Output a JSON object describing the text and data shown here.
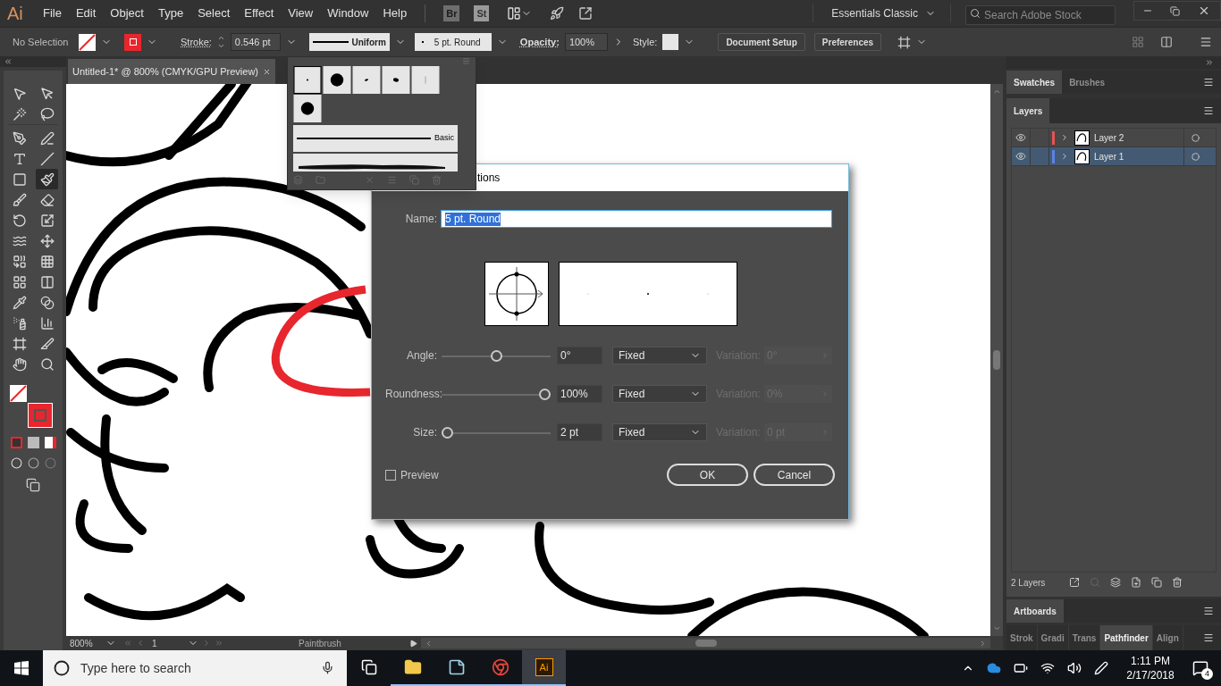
{
  "app": {
    "logo": "Ai",
    "bridge": "Br",
    "stock": "St"
  },
  "menu": [
    "File",
    "Edit",
    "Object",
    "Type",
    "Select",
    "Effect",
    "View",
    "Window",
    "Help"
  ],
  "workspace": {
    "label": "Essentials Classic"
  },
  "stock_search": {
    "placeholder": "Search Adobe Stock"
  },
  "control_bar": {
    "selection": "No Selection",
    "stroke_label": "Stroke:",
    "stroke_value": "0.546 pt",
    "profile": "Uniform",
    "brush": "5 pt. Round",
    "opacity_label": "Opacity:",
    "opacity_value": "100%",
    "style_label": "Style:",
    "buttons": [
      "Document Setup",
      "Preferences"
    ]
  },
  "tools": [
    {
      "kind": "selection",
      "selected": false
    },
    {
      "kind": "direct-selection",
      "selected": false
    },
    {
      "kind": "magic-wand",
      "selected": false
    },
    {
      "kind": "lasso",
      "selected": false
    },
    {
      "kind": "pen",
      "selected": false
    },
    {
      "kind": "curvature",
      "selected": false
    },
    {
      "kind": "type",
      "selected": false
    },
    {
      "kind": "line",
      "selected": false
    },
    {
      "kind": "rectangle",
      "selected": false
    },
    {
      "kind": "paintbrush",
      "selected": true
    },
    {
      "kind": "shaper",
      "selected": false
    },
    {
      "kind": "eraser",
      "selected": false
    },
    {
      "kind": "rotate",
      "selected": false
    },
    {
      "kind": "scale",
      "selected": false
    },
    {
      "kind": "width",
      "selected": false
    },
    {
      "kind": "free-transform",
      "selected": false
    },
    {
      "kind": "shape-builder",
      "selected": false
    },
    {
      "kind": "perspective",
      "selected": false
    },
    {
      "kind": "mesh",
      "selected": false
    },
    {
      "kind": "gradient",
      "selected": false
    },
    {
      "kind": "eyedropper",
      "selected": false
    },
    {
      "kind": "blend",
      "selected": false
    },
    {
      "kind": "symbol-sprayer",
      "selected": false
    },
    {
      "kind": "graph",
      "selected": false
    },
    {
      "kind": "artboard",
      "selected": false
    },
    {
      "kind": "slice",
      "selected": false
    },
    {
      "kind": "hand",
      "selected": false
    },
    {
      "kind": "zoom",
      "selected": false
    }
  ],
  "document_tab": {
    "title": "Untitled-1* @ 800% (CMYK/GPU Preview)"
  },
  "brush_popup": {
    "brushes": [
      {
        "kind": "dot",
        "selected": true
      },
      {
        "kind": "blob",
        "selected": false
      },
      {
        "kind": "tilt",
        "selected": false
      },
      {
        "kind": "oval",
        "selected": false
      },
      {
        "kind": "tick",
        "selected": false
      },
      {
        "kind": "blob",
        "selected": false
      }
    ],
    "rows": [
      {
        "kind": "line",
        "label": "Basic"
      },
      {
        "kind": "charcoal"
      }
    ]
  },
  "dialog": {
    "title": "tions",
    "name_label": "Name:",
    "name_value": "5 pt. Round",
    "sliders": [
      {
        "label": "Angle:",
        "level": 0.5,
        "value": "0°",
        "mode": "Fixed",
        "variation_label": "Variation:",
        "variation_value": "0°",
        "disabled": true
      },
      {
        "label": "Roundness:",
        "level": 1,
        "value": "100%",
        "mode": "Fixed",
        "variation_label": "Variation:",
        "variation_value": "0%",
        "disabled": true
      },
      {
        "label": "Size:",
        "level": 0,
        "value": "2 pt",
        "mode": "Fixed",
        "variation_label": "Variation:",
        "variation_value": "0 pt",
        "disabled": true
      }
    ],
    "preview": {
      "label": "Preview",
      "checked": false
    },
    "buttons": [
      "OK",
      "Cancel"
    ]
  },
  "panels": {
    "tabs": [
      {
        "label": "Swatches",
        "selected": true
      },
      {
        "label": "Brushes",
        "selected": false
      }
    ],
    "layers_title": "Layers",
    "layers": [
      {
        "name": "Layer 2",
        "color": "#e85252",
        "visible": true,
        "selected": false
      },
      {
        "name": "Layer 1",
        "color": "#5a82e6",
        "visible": true,
        "selected": true
      }
    ],
    "count": "2 Layers",
    "artboards": "Artboards",
    "bottom_tabs": [
      {
        "label": "Strok",
        "selected": false
      },
      {
        "label": "Gradi",
        "selected": false
      },
      {
        "label": "Trans",
        "selected": false
      },
      {
        "label": "Pathfinder",
        "selected": true
      },
      {
        "label": "Align",
        "selected": false
      }
    ]
  },
  "status_bar": {
    "zoom": "800%",
    "artboard": "1",
    "tool": "Paintbrush"
  },
  "taskbar": {
    "search_placeholder": "Type here to search",
    "apps": [
      {
        "kind": "task-view",
        "open": false,
        "active": false
      },
      {
        "kind": "explorer",
        "open": true,
        "active": false
      },
      {
        "kind": "notes",
        "open": true,
        "active": false
      },
      {
        "kind": "chrome",
        "open": true,
        "active": false
      },
      {
        "kind": "illustrator",
        "label": "Ai",
        "open": true,
        "active": true
      }
    ],
    "time": "1:11 PM",
    "date": "2/17/2018",
    "notifications": "4"
  }
}
